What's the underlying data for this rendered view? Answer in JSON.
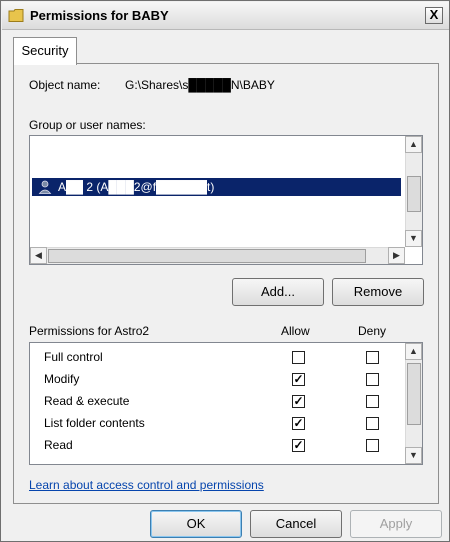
{
  "window": {
    "title": "Permissions for BABY",
    "close_glyph": "X",
    "folder_icon_color": "#e8c44c"
  },
  "tab": {
    "label": "Security"
  },
  "object": {
    "label": "Object name:",
    "value": "G:\\Shares\\s█████N\\BABY"
  },
  "groups": {
    "label": "Group or user names:",
    "users": [
      {
        "name": "A██ 2 (A███2@f██████t)",
        "selected": true
      }
    ]
  },
  "buttons": {
    "add": "Add...",
    "remove": "Remove",
    "ok": "OK",
    "cancel": "Cancel",
    "apply": "Apply"
  },
  "permissions": {
    "label": "Permissions for Astro2",
    "allow_header": "Allow",
    "deny_header": "Deny",
    "rows": [
      {
        "name": "Full control",
        "allow": false,
        "deny": false
      },
      {
        "name": "Modify",
        "allow": true,
        "deny": false
      },
      {
        "name": "Read & execute",
        "allow": true,
        "deny": false
      },
      {
        "name": "List folder contents",
        "allow": true,
        "deny": false
      },
      {
        "name": "Read",
        "allow": true,
        "deny": false
      }
    ]
  },
  "link": {
    "text": "Learn about access control and permissions"
  },
  "colors": {
    "selection": "#0a246a",
    "link": "#0645ad"
  }
}
